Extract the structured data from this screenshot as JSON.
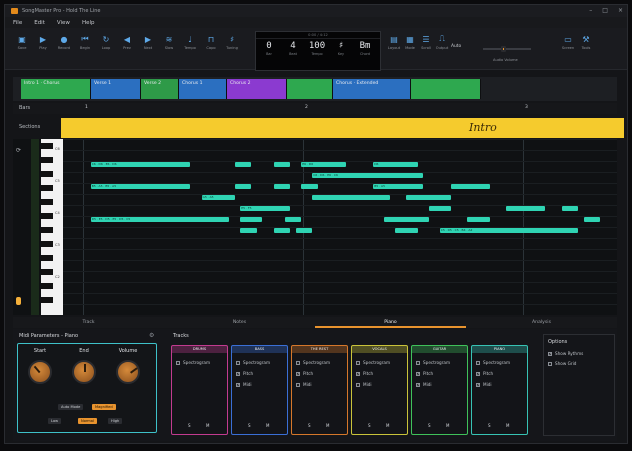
{
  "window": {
    "title": "SongMaster Pro - Hold The Line",
    "controls": [
      "–",
      "□",
      "×"
    ]
  },
  "menu": [
    "File",
    "Edit",
    "View",
    "Help"
  ],
  "toolbar": {
    "left": [
      {
        "icon": "save-icon",
        "label": "Save"
      },
      {
        "icon": "play-icon",
        "label": "Play"
      },
      {
        "icon": "record-icon",
        "label": "Record"
      },
      {
        "icon": "rewind-icon",
        "label": "Begin"
      },
      {
        "icon": "loop-icon",
        "label": "Loop"
      },
      {
        "icon": "prev-icon",
        "label": "Prev"
      },
      {
        "icon": "next-icon",
        "label": "Next"
      },
      {
        "icon": "speed-icon",
        "label": "Slow"
      },
      {
        "icon": "tempo-icon",
        "label": "Tempo"
      },
      {
        "icon": "capo-icon",
        "label": "Capo"
      },
      {
        "icon": "tuning-icon",
        "label": "Tuning"
      }
    ],
    "right": [
      {
        "icon": "layout-icon",
        "label": "Layout"
      },
      {
        "icon": "mode-icon",
        "label": "Mode"
      },
      {
        "icon": "scroll-icon",
        "label": "Scroll"
      },
      {
        "icon": "output-icon",
        "label": "Output"
      }
    ],
    "far_right": [
      {
        "icon": "screen-icon",
        "label": "Screen"
      },
      {
        "icon": "tools-icon",
        "label": "Tools"
      }
    ],
    "slider_label": "Audio Volume",
    "slider_value": 0.42,
    "output_value": "Auto"
  },
  "lcd": {
    "head": "0:00 / 4:12",
    "cells": [
      {
        "value": "0",
        "label": "Bar"
      },
      {
        "value": "4",
        "label": "Beat"
      },
      {
        "value": "100",
        "label": "Tempo"
      },
      {
        "value": "♯",
        "label": "Key"
      },
      {
        "value": "Bm",
        "label": "Chord"
      }
    ]
  },
  "sections_lane": [
    {
      "label": "Intro 1 · Chorus",
      "color": "#2ea84f"
    },
    {
      "label": "Verse 1",
      "color": "#2b6fc0"
    },
    {
      "label": "Verse 2",
      "color": "#2e9a48"
    },
    {
      "label": "Chorus 1",
      "color": "#2b6fc0"
    },
    {
      "label": "Chorus 2",
      "color": "#8b3ad0"
    },
    {
      "label": "",
      "color": "#2ea84f"
    },
    {
      "label": "Chorus · Extended",
      "color": "#2b6fc0"
    },
    {
      "label": "",
      "color": "#2ea84f"
    }
  ],
  "rows": {
    "bars": "Bars",
    "sections": "Sections",
    "intro": "Intro"
  },
  "tabs": [
    {
      "label": "Track",
      "active": false
    },
    {
      "label": "Notes",
      "active": false
    },
    {
      "label": "Piano",
      "active": true
    },
    {
      "label": "Analysis",
      "active": false
    }
  ],
  "midi_panel": {
    "title": "Midi Parameters - Piano",
    "knobs": [
      {
        "label": "Start",
        "value": 0.35
      },
      {
        "label": "End",
        "value": 0.5
      },
      {
        "label": "Volume",
        "value": 0.7
      }
    ],
    "mode_pills": [
      {
        "label": "Auto Mode",
        "on": false
      },
      {
        "label": "Magnified",
        "on": true
      }
    ],
    "range_pills": [
      {
        "label": "Low",
        "on": false
      },
      {
        "label": "Normal",
        "on": true
      },
      {
        "label": "High",
        "on": false
      }
    ]
  },
  "tracks_title": "Tracks",
  "tracks": [
    {
      "name": "DRUMS",
      "color": "#c23b8f",
      "items": [
        {
          "label": "Spectrogram",
          "checked": false
        }
      ]
    },
    {
      "name": "BASS",
      "color": "#3a6fd6",
      "items": [
        {
          "label": "Spectrogram",
          "checked": false
        },
        {
          "label": "Pitch",
          "checked": true
        },
        {
          "label": "Midi",
          "checked": true
        }
      ]
    },
    {
      "name": "THE REST",
      "color": "#d5772a",
      "items": [
        {
          "label": "Spectrogram",
          "checked": false
        },
        {
          "label": "Pitch",
          "checked": true
        },
        {
          "label": "Midi",
          "checked": false
        }
      ]
    },
    {
      "name": "VOCALS",
      "color": "#c9c33a",
      "items": [
        {
          "label": "Spectrogram",
          "checked": false
        },
        {
          "label": "Pitch",
          "checked": true
        },
        {
          "label": "Midi",
          "checked": false
        }
      ]
    },
    {
      "name": "GUITAR",
      "color": "#3fc15a",
      "items": [
        {
          "label": "Spectrogram",
          "checked": false
        },
        {
          "label": "Pitch",
          "checked": true
        },
        {
          "label": "Midi",
          "checked": true
        }
      ]
    },
    {
      "name": "PIANO",
      "color": "#37c3b4",
      "items": [
        {
          "label": "Spectrogram",
          "checked": false
        },
        {
          "label": "Pitch",
          "checked": true
        },
        {
          "label": "Midi",
          "checked": true
        }
      ]
    }
  ],
  "solo_label": "S",
  "mute_label": "M",
  "options": {
    "title": "Options",
    "items": [
      {
        "label": "Show Rythms",
        "checked": true
      },
      {
        "label": "Show Grid",
        "checked": false
      }
    ]
  },
  "bar_numbers": [
    "1",
    "2",
    "3"
  ],
  "key_labels": [
    "C6",
    "C5",
    "C4",
    "C3",
    "C2"
  ],
  "notes": [
    {
      "lane": 2,
      "start": 0.05,
      "len": 0.18,
      "text": "C6 · D6 · E6 · D6"
    },
    {
      "lane": 2,
      "start": 0.31,
      "len": 0.03,
      "text": ""
    },
    {
      "lane": 2,
      "start": 0.38,
      "len": 0.03,
      "text": ""
    },
    {
      "lane": 2,
      "start": 0.43,
      "len": 0.08,
      "text": "E6 · D6"
    },
    {
      "lane": 2,
      "start": 0.56,
      "len": 0.08,
      "text": "D6"
    },
    {
      "lane": 3,
      "start": 0.45,
      "len": 0.2,
      "text": "C6 · D6 · E6 · C6"
    },
    {
      "lane": 4,
      "start": 0.05,
      "len": 0.18,
      "text": "B5 · A5 · B5 · A5"
    },
    {
      "lane": 4,
      "start": 0.31,
      "len": 0.03,
      "text": ""
    },
    {
      "lane": 4,
      "start": 0.38,
      "len": 0.03,
      "text": ""
    },
    {
      "lane": 4,
      "start": 0.43,
      "len": 0.03,
      "text": ""
    },
    {
      "lane": 4,
      "start": 0.56,
      "len": 0.09,
      "text": "B5 · A5"
    },
    {
      "lane": 4,
      "start": 0.7,
      "len": 0.07,
      "text": ""
    },
    {
      "lane": 5,
      "start": 0.25,
      "len": 0.06,
      "text": "G5 · A5"
    },
    {
      "lane": 5,
      "start": 0.45,
      "len": 0.14,
      "text": ""
    },
    {
      "lane": 5,
      "start": 0.62,
      "len": 0.08,
      "text": ""
    },
    {
      "lane": 6,
      "start": 0.32,
      "len": 0.09,
      "text": "E5 · F5"
    },
    {
      "lane": 6,
      "start": 0.66,
      "len": 0.04,
      "text": ""
    },
    {
      "lane": 6,
      "start": 0.8,
      "len": 0.07,
      "text": ""
    },
    {
      "lane": 6,
      "start": 0.9,
      "len": 0.03,
      "text": ""
    },
    {
      "lane": 7,
      "start": 0.05,
      "len": 0.25,
      "text": "D5 · E5 · D5 · E5 · D5 · C5"
    },
    {
      "lane": 7,
      "start": 0.32,
      "len": 0.04,
      "text": ""
    },
    {
      "lane": 7,
      "start": 0.4,
      "len": 0.03,
      "text": ""
    },
    {
      "lane": 7,
      "start": 0.58,
      "len": 0.08,
      "text": ""
    },
    {
      "lane": 7,
      "start": 0.73,
      "len": 0.04,
      "text": ""
    },
    {
      "lane": 7,
      "start": 0.94,
      "len": 0.03,
      "text": ""
    },
    {
      "lane": 8,
      "start": 0.32,
      "len": 0.03,
      "text": ""
    },
    {
      "lane": 8,
      "start": 0.38,
      "len": 0.03,
      "text": ""
    },
    {
      "lane": 8,
      "start": 0.42,
      "len": 0.03,
      "text": ""
    },
    {
      "lane": 8,
      "start": 0.6,
      "len": 0.04,
      "text": ""
    },
    {
      "lane": 8,
      "start": 0.68,
      "len": 0.25,
      "text": "C5 · D5 · C5 · B4 · A4"
    }
  ]
}
